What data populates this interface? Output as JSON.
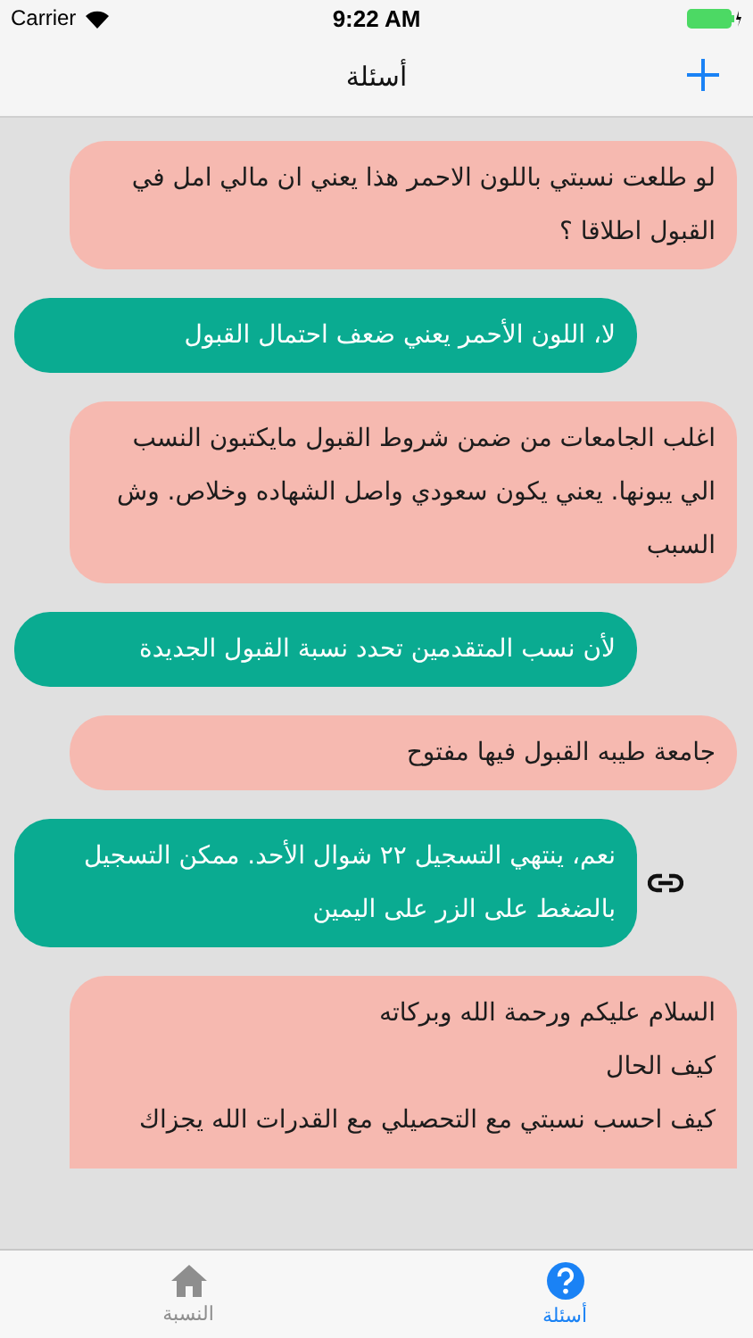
{
  "status_bar": {
    "carrier": "Carrier",
    "time": "9:22 AM"
  },
  "nav": {
    "title": "أسئلة"
  },
  "messages": [
    {
      "kind": "question",
      "lines": [
        "لو طلعت نسبتي باللون الاحمر هذا يعني ان مالي امل في القبول اطلاقا ؟"
      ]
    },
    {
      "kind": "answer",
      "lines": [
        "لا، اللون الأحمر يعني ضعف احتمال القبول"
      ],
      "has_link": false
    },
    {
      "kind": "question",
      "lines": [
        "اغلب الجامعات من ضمن شروط القبول مايكتبون النسب الي يبونها. يعني يكون سعودي واصل الشهاده وخلاص. وش السبب"
      ]
    },
    {
      "kind": "answer",
      "lines": [
        "لأن نسب المتقدمين تحدد نسبة القبول الجديدة"
      ],
      "has_link": false
    },
    {
      "kind": "question",
      "lines": [
        "جامعة طيبه القبول فيها مفتوح"
      ]
    },
    {
      "kind": "answer",
      "lines": [
        "نعم، ينتهي التسجيل ٢٢ شوال الأحد. ممكن التسجيل بالضغط على الزر على اليمين"
      ],
      "has_link": true
    },
    {
      "kind": "question",
      "lines": [
        "السلام عليكم ورحمة الله وبركاته",
        "كيف الحال",
        "كيف احسب نسبتي مع التحصيلي مع القدرات الله يجزاك"
      ],
      "cut_off": true
    }
  ],
  "tabs": [
    {
      "label": "أسئلة",
      "selected": true
    },
    {
      "label": "النسبة",
      "selected": false
    }
  ]
}
